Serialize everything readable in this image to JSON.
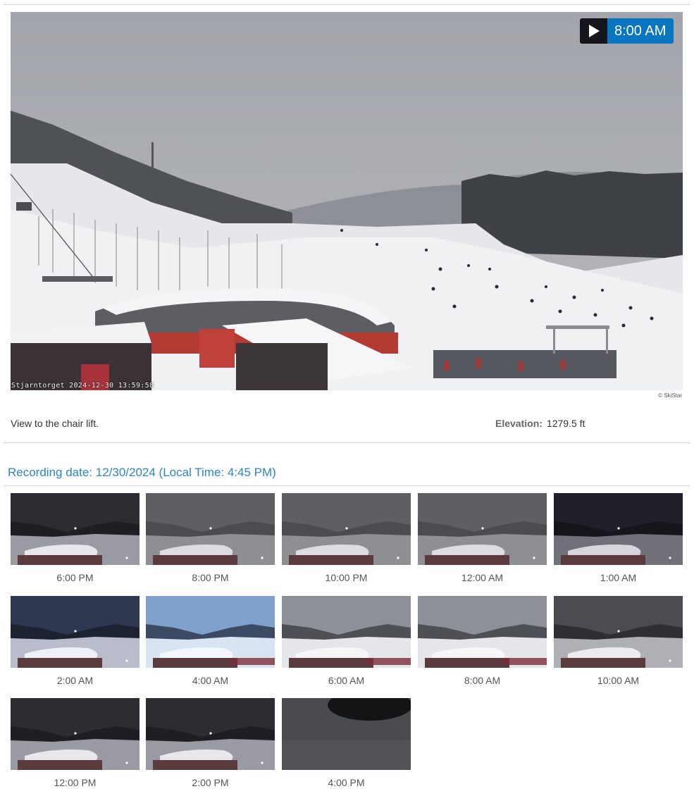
{
  "player": {
    "current_time": "8:00 AM",
    "cam_overlay": "Stjarntorget 2024-12-30 13:59:58",
    "copyright": "© SkiStar"
  },
  "info": {
    "caption": "View to the chair lift.",
    "elevation_label": "Elevation:",
    "elevation_value": "1279.5 ft"
  },
  "recording": {
    "date_text": "Recording date: 12/30/2024 (Local Time: 4:45 PM)"
  },
  "thumbnails": [
    {
      "time": "6:00 PM",
      "scene": "night"
    },
    {
      "time": "8:00 PM",
      "scene": "fog"
    },
    {
      "time": "10:00 PM",
      "scene": "fog"
    },
    {
      "time": "12:00 AM",
      "scene": "fog"
    },
    {
      "time": "1:00 AM",
      "scene": "dark"
    },
    {
      "time": "2:00 AM",
      "scene": "dawn"
    },
    {
      "time": "4:00 AM",
      "scene": "blue"
    },
    {
      "time": "6:00 AM",
      "scene": "day"
    },
    {
      "time": "8:00 AM",
      "scene": "day"
    },
    {
      "time": "10:00 AM",
      "scene": "dusk"
    },
    {
      "time": "12:00 PM",
      "scene": "night"
    },
    {
      "time": "2:00 PM",
      "scene": "night"
    },
    {
      "time": "4:00 PM",
      "scene": "blocked"
    }
  ],
  "colors": {
    "accent": "#0a76c0",
    "link": "#2a86c6",
    "play_bg": "#15161c"
  },
  "icons": {
    "play": "play-icon"
  }
}
